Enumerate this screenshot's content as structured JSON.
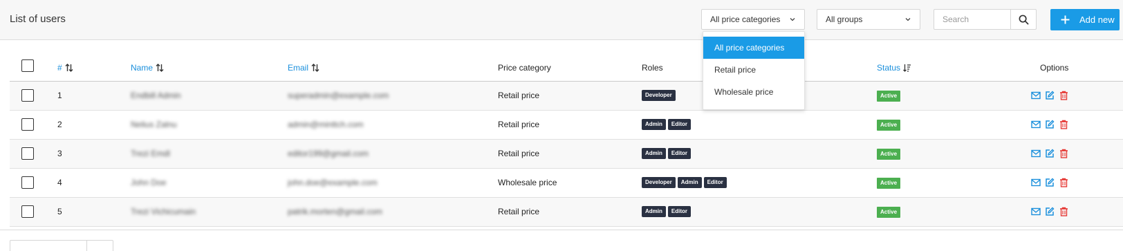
{
  "header": {
    "title": "List of users",
    "price_filter": "All price categories",
    "group_filter": "All groups",
    "search_placeholder": "Search",
    "add_label": "Add new"
  },
  "dropdown": {
    "options": [
      "All price categories",
      "Retail price",
      "Wholesale price"
    ],
    "selected_index": 0
  },
  "table": {
    "columns": {
      "num": "#",
      "name": "Name",
      "email": "Email",
      "price": "Price category",
      "roles": "Roles",
      "status": "Status",
      "options": "Options"
    },
    "rows": [
      {
        "num": "1",
        "name": "Endbill Admin",
        "email": "superadmin@example.com",
        "price": "Retail price",
        "roles": [
          "Developer"
        ],
        "status": "Active"
      },
      {
        "num": "2",
        "name": "Nelius Zalnu",
        "email": "admin@minttch.com",
        "price": "Retail price",
        "roles": [
          "Admin",
          "Editor"
        ],
        "status": "Active"
      },
      {
        "num": "3",
        "name": "Trezi Emdl",
        "email": "editor199@gmail.com",
        "price": "Retail price",
        "roles": [
          "Admin",
          "Editor"
        ],
        "status": "Active"
      },
      {
        "num": "4",
        "name": "John Doe",
        "email": "john.doe@example.com",
        "price": "Wholesale price",
        "roles": [
          "Developer",
          "Admin",
          "Editor"
        ],
        "status": "Active"
      },
      {
        "num": "5",
        "name": "Trezi Vichicumain",
        "email": "patrik.morten@gmail.com",
        "price": "Retail price",
        "roles": [
          "Admin",
          "Editor"
        ],
        "status": "Active"
      }
    ]
  },
  "colors": {
    "accent": "#1a9be6",
    "status_active": "#4caf50",
    "role_tag": "#2a3142",
    "delete": "#e53935"
  },
  "icons": {
    "search": "search-icon",
    "add": "plus-icon",
    "sort": "sort-icon",
    "mail": "mail-icon",
    "edit": "edit-icon",
    "delete": "trash-icon",
    "dropdown": "chevron-down-icon"
  }
}
